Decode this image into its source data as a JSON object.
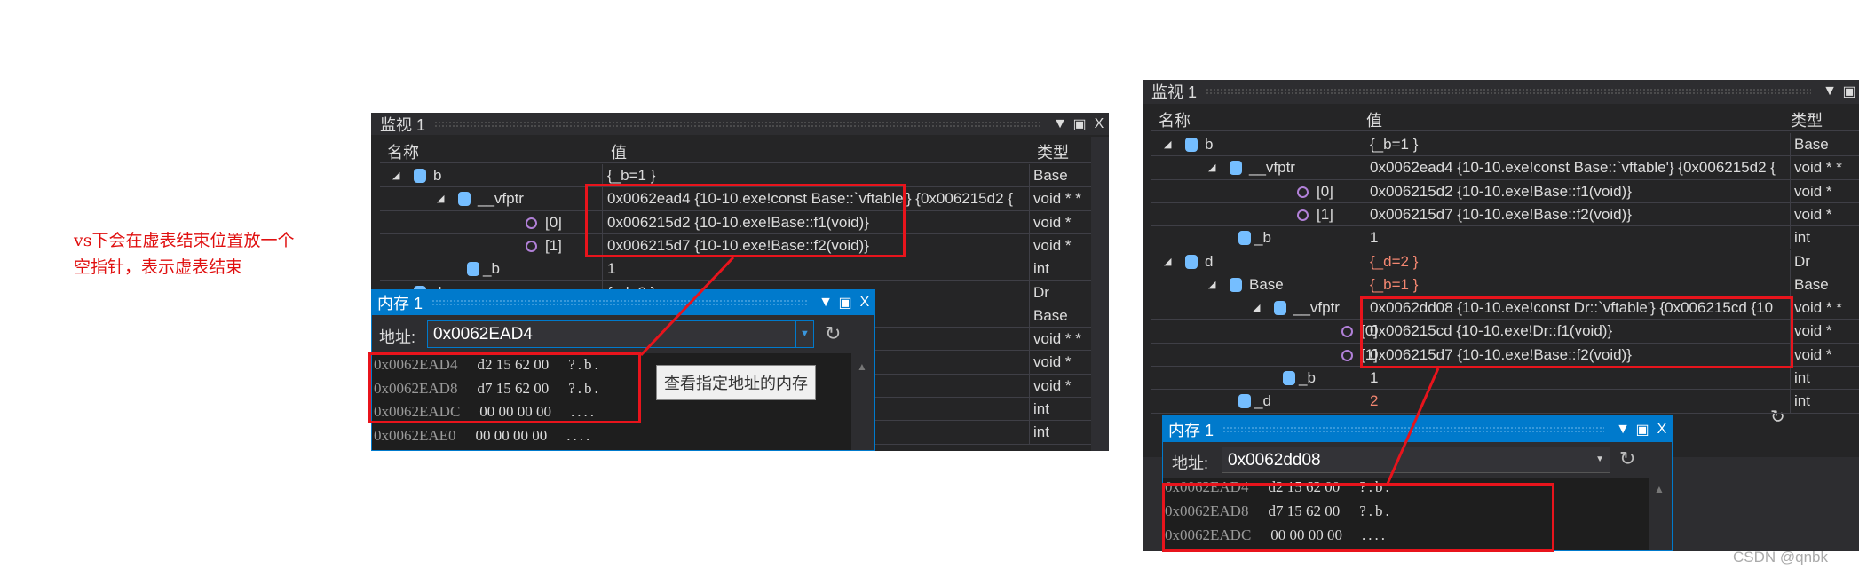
{
  "annotation": {
    "line1": "vs下会在虚表结束位置放一个",
    "line2": "空指针，表示虚表结束"
  },
  "left_watch": {
    "title": "监视 1",
    "columns": {
      "name": "名称",
      "value": "值",
      "type": "类型"
    },
    "rows": [
      {
        "indent": 0,
        "expander": "▲",
        "icon": "cube",
        "name": "b",
        "value": "{_b=1 }",
        "type": "Base"
      },
      {
        "indent": 1,
        "expander": "▲",
        "icon": "cube",
        "name": "__vfptr",
        "value": "0x0062ead4 {10-10.exe!const Base::`vftable'} {0x006215d2 {",
        "type": "void * *"
      },
      {
        "indent": 2,
        "icon": "method",
        "name": "[0]",
        "value": "0x006215d2 {10-10.exe!Base::f1(void)}",
        "type": "void *"
      },
      {
        "indent": 2,
        "icon": "method",
        "name": "[1]",
        "value": "0x006215d7 {10-10.exe!Base::f2(void)}",
        "type": "void *"
      },
      {
        "indent": 1,
        "icon": "field-locked",
        "name": "_b",
        "value": "1",
        "type": "int"
      },
      {
        "indent": 0,
        "expander": "▲",
        "icon": "cube",
        "name": "d",
        "value": "{_d=2 }",
        "type": "Dr"
      },
      {
        "indent": 1,
        "name": "",
        "value": "",
        "type": "Base"
      },
      {
        "indent": 1,
        "name": "",
        "value": "le'} {0x006215cd {10",
        "type": "void * *"
      },
      {
        "indent": 2,
        "name": "",
        "value": "",
        "type": "void *"
      },
      {
        "indent": 2,
        "name": "",
        "value": "",
        "type": "void *"
      },
      {
        "indent": 1,
        "name": "",
        "value": "",
        "type": "int"
      },
      {
        "indent": 1,
        "name": "",
        "value": "",
        "type": "int"
      }
    ]
  },
  "left_memory": {
    "title": "内存 1",
    "address_label": "地址:",
    "address_value": "0x0062EAD4",
    "tooltip": "查看指定地址的内存",
    "rows": [
      {
        "addr": "0x0062EAD4",
        "bytes": "d2 15 62 00",
        "ascii": "?.b."
      },
      {
        "addr": "0x0062EAD8",
        "bytes": "d7 15 62 00",
        "ascii": "?.b."
      },
      {
        "addr": "0x0062EADC",
        "bytes": "00 00 00 00",
        "ascii": "...."
      },
      {
        "addr": "0x0062EAE0",
        "bytes": "00 00 00 00",
        "ascii": "...."
      }
    ]
  },
  "right_watch": {
    "title": "监视 1",
    "columns": {
      "name": "名称",
      "value": "值",
      "type": "类型"
    },
    "rows": [
      {
        "indent": 0,
        "expander": "▲",
        "icon": "cube",
        "name": "b",
        "value": "{_b=1 }",
        "type": "Base"
      },
      {
        "indent": 1,
        "expander": "▲",
        "icon": "cube",
        "name": "__vfptr",
        "value": "0x0062ead4 {10-10.exe!const Base::`vftable'} {0x006215d2 {",
        "type": "void * *"
      },
      {
        "indent": 2,
        "icon": "method",
        "name": "[0]",
        "value": "0x006215d2 {10-10.exe!Base::f1(void)}",
        "type": "void *"
      },
      {
        "indent": 2,
        "icon": "method",
        "name": "[1]",
        "value": "0x006215d7 {10-10.exe!Base::f2(void)}",
        "type": "void *"
      },
      {
        "indent": 1,
        "icon": "field-locked",
        "name": "_b",
        "value": "1",
        "type": "int"
      },
      {
        "indent": 0,
        "expander": "▲",
        "icon": "cube",
        "name": "d",
        "value": "{_d=2 }",
        "type": "Dr",
        "changed": true
      },
      {
        "indent": 1,
        "expander": "▲",
        "icon": "cube",
        "name": "Base",
        "value": "{_b=1 }",
        "type": "Base",
        "changed": true
      },
      {
        "indent": 2,
        "expander": "▲",
        "icon": "cube",
        "name": "__vfptr",
        "value": "0x0062dd08 {10-10.exe!const Dr::`vftable'} {0x006215cd {10",
        "type": "void * *"
      },
      {
        "indent": 3,
        "icon": "method",
        "name": "[0]",
        "value": "0x006215cd {10-10.exe!Dr::f1(void)}",
        "type": "void *"
      },
      {
        "indent": 3,
        "icon": "method",
        "name": "[1]",
        "value": "0x006215d7 {10-10.exe!Base::f2(void)}",
        "type": "void *"
      },
      {
        "indent": 2,
        "icon": "field-locked",
        "name": "_b",
        "value": "1",
        "type": "int"
      },
      {
        "indent": 1,
        "icon": "field-locked",
        "name": "_d",
        "value": "2",
        "type": "int",
        "changed": true
      }
    ]
  },
  "right_memory": {
    "title": "内存 1",
    "address_label": "地址:",
    "address_value": "0x0062dd08",
    "rows": [
      {
        "addr": "0x0062EAD4",
        "bytes": "d2 15 62 00",
        "ascii": "?.b."
      },
      {
        "addr": "0x0062EAD8",
        "bytes": "d7 15 62 00",
        "ascii": "?.b."
      },
      {
        "addr": "0x0062EADC",
        "bytes": "00 00 00 00",
        "ascii": "...."
      }
    ]
  },
  "watermark": "CSDN @qnbk",
  "colors": {
    "accent": "#007acc",
    "highlight_box": "#e8141c",
    "changed_value": "#f48771",
    "annotation": "#e01010"
  }
}
